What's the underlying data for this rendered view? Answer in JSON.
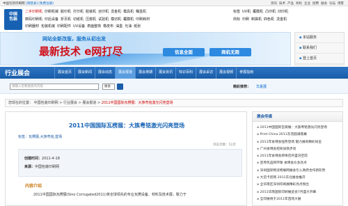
{
  "topbar": {
    "site": "中国包装印刷网",
    "register": "[请登录]",
    "free": "[免费注册]"
  },
  "topnav": [
    "资讯",
    "技术",
    "产品",
    "商机",
    "企业",
    "招聘",
    "展会",
    "论坛",
    "博客"
  ],
  "logo": {
    "line1": "中国",
    "line2": "包装"
  },
  "categories": {
    "row1": [
      "二手印刷机",
      "印刷机械",
      "胶印机",
      "打印机",
      "胶装机",
      "丝印机",
      "烫金机",
      "模具机",
      "糊盒机"
    ],
    "row2": [
      "数码印刷机",
      "印后设备",
      "折页机",
      "切纸机",
      "压痕机",
      "试验机",
      "模切机",
      "覆膜机",
      "印刷耗材"
    ],
    "row3": [
      "印刷器材",
      "包装机械",
      "印刷配件",
      "UV设备",
      "表面整饰",
      "橡皮布",
      "油墨",
      "光油",
      "纸张"
    ]
  },
  "categories_right": {
    "row1": [
      "标签",
      "UV机",
      "覆膜机",
      "凸印机",
      "凹印机"
    ],
    "row2": [
      "商标",
      "印刷",
      "制袋机",
      "四色机",
      "烫金机"
    ]
  },
  "banner": {
    "subtitle": "网站全新改版，服务从初出发",
    "headline": "最新技术 e网打尽",
    "tag1": "信息全面",
    "tag2": "商机无限"
  },
  "rightbox": [
    "本站服务",
    "联系我们",
    "登上首页"
  ],
  "mainnav": {
    "brand": "行业展会",
    "items": [
      "展会首页",
      "展会新闻",
      "展会动态",
      "展会报道",
      "展会排期",
      "展会资讯",
      "知识百科",
      "展会采访",
      "展会视频",
      "参展指南"
    ],
    "active_index": 3
  },
  "search": {
    "placeholder": "请输入您要搜索的内容",
    "select": "展会",
    "hot_label": "精彩推荐：",
    "hot_value": "华夏展"
  },
  "breadcrumb": {
    "prefix": "您现在的位置：",
    "items": [
      "中国包装印刷网",
      "行业展会",
      "展会报道"
    ],
    "current": "2011中国国际瓦楞展：大族粤铭激光闪亮登场"
  },
  "article": {
    "title": "2011中国国际瓦楞展：大族粤铭激光闪亮登场",
    "tag": "标签：瓦楞展,大族粤铭,登场",
    "views": "浏览次数：52次",
    "created_label": "创建时间：",
    "created": "2011-4-18",
    "source_label": "来源：",
    "source": "中国包装印刷网",
    "intro_heading": "内容介绍",
    "intro_text": "2011中国国际瓦楞展(Sino Corrugated2011)将全球领先的专业瓦楞设备、材料及技术展，致力于"
  },
  "sidebar": {
    "heading": "展会传媒",
    "items": [
      "2011中国国际瓦楞展：大族粤铭激光闪亮登场",
      "Print China 2011东莞圆满落幕",
      "2011年食博会强势登场 魅力展商精彩纷呈",
      "广州食博会招商加快步伐",
      "2011年食博会即将召开盛况空前",
      "宣传风品牌环球 食博会众多亮点",
      "深圳国际物流物联网展会引入政府合作新形势",
      "大迈卡尼网 2011东北展会推开",
      "全华南区深圳印刷展精彩亮点频出",
      "2011华南国际印刷展览会7月盛大开幕",
      "全印展将于2011年首场大展"
    ]
  },
  "colors": {
    "brand_blue": "#1b5da8",
    "title_blue": "#1763b5",
    "accent_red": "#d0101a",
    "intro_orange": "#c97a14"
  }
}
